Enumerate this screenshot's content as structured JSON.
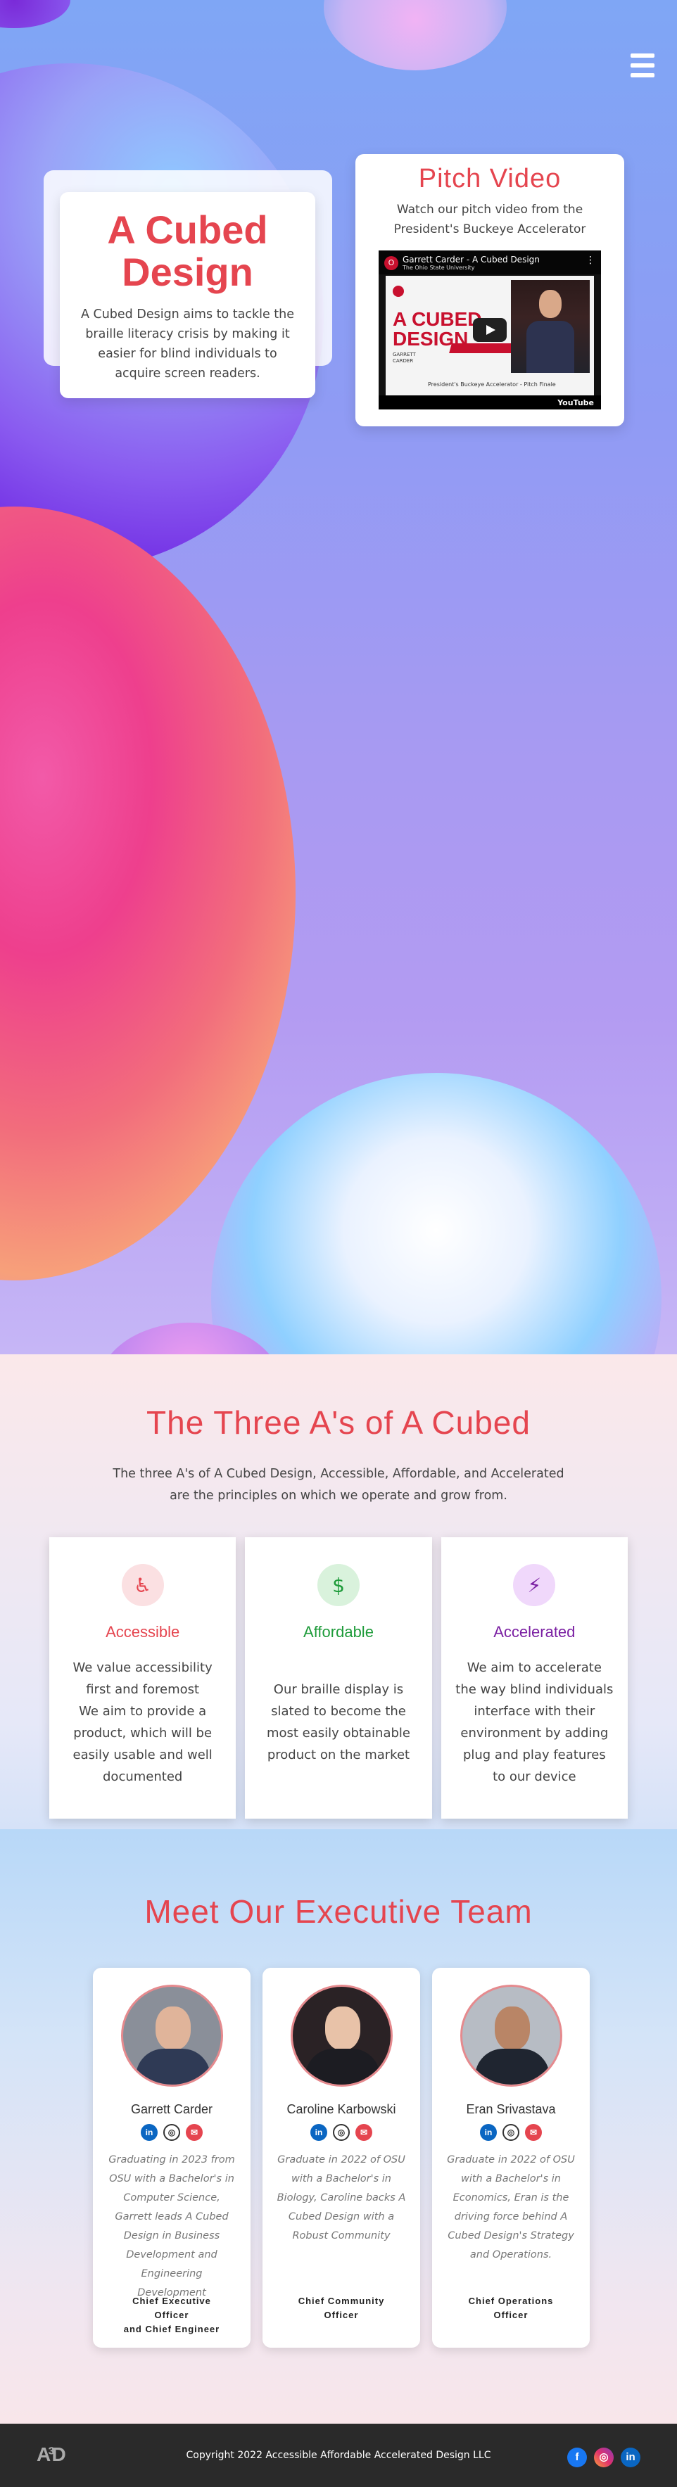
{
  "hero": {
    "title": "A Cubed Design",
    "description": "A Cubed Design aims to tackle the braille literacy crisis by making it easier for blind individuals to acquire screen readers.",
    "menu_icon": "hamburger-menu-icon"
  },
  "pitch": {
    "title": "Pitch Video",
    "text": "Watch our pitch video from the President's Buckeye Accelerator",
    "video": {
      "title": "Garrett Carder - A Cubed Design",
      "channel": "The Ohio State University",
      "slide_heading_line1": "A CUBED",
      "slide_heading_line2": "DESIGN",
      "slide_sub": "GARRETT\nCARDER",
      "slide_caption": "President's Buckeye Accelerator - Pitch Finale",
      "brand": "YouTube"
    }
  },
  "three_as": {
    "title": "The Three A's of A Cubed",
    "lead": "The three A's of A Cubed Design, Accessible, Affordable, and Accelerated are the principles on which we operate and grow from.",
    "cards": [
      {
        "name": "Accessible",
        "text": "We value accessibility first and foremost\nWe aim to provide a product, which will be easily usable and well documented",
        "color": "#e5454f",
        "icon": "accessibility-icon"
      },
      {
        "name": "Affordable",
        "text": "Our braille display is slated to become the most easily obtainable product on the market",
        "color": "#1e9b3a",
        "icon": "money-icon"
      },
      {
        "name": "Accelerated",
        "text": "We aim to accelerate the way blind individuals interface with their environment by adding plug and play features to our device",
        "color": "#7a1fa2",
        "icon": "lightning-icon"
      }
    ]
  },
  "team": {
    "title": "Meet Our Executive Team",
    "members": [
      {
        "name": "Garrett Carder",
        "bio": "Graduating in 2023 from OSU with a Bachelor's in Computer Science, Garrett leads A Cubed Design in Business Development and Engineering Development",
        "role": "Chief Executive\nOfficer\nand Chief Engineer"
      },
      {
        "name": "Caroline Karbowski",
        "bio": "Graduate in 2022 of OSU with a Bachelor's in Biology, Caroline backs A Cubed Design with a Robust Community",
        "role": "Chief Community\nOfficer"
      },
      {
        "name": "Eran Srivastava",
        "bio": "Graduate in 2022 of OSU with a Bachelor's in Economics, Eran is the driving force behind A Cubed Design's Strategy and Operations.",
        "role": "Chief Operations\nOfficer"
      }
    ]
  },
  "footer": {
    "logo": "A³D",
    "copyright": "Copyright 2022 Accessible Affordable Accelerated Design LLC",
    "social": [
      "facebook-icon",
      "instagram-icon",
      "linkedin-icon"
    ]
  },
  "colors": {
    "accent": "#e5454f",
    "affordable": "#1e9b3a",
    "accelerated": "#7a1fa2",
    "footer_bg": "#2a2a2a"
  }
}
